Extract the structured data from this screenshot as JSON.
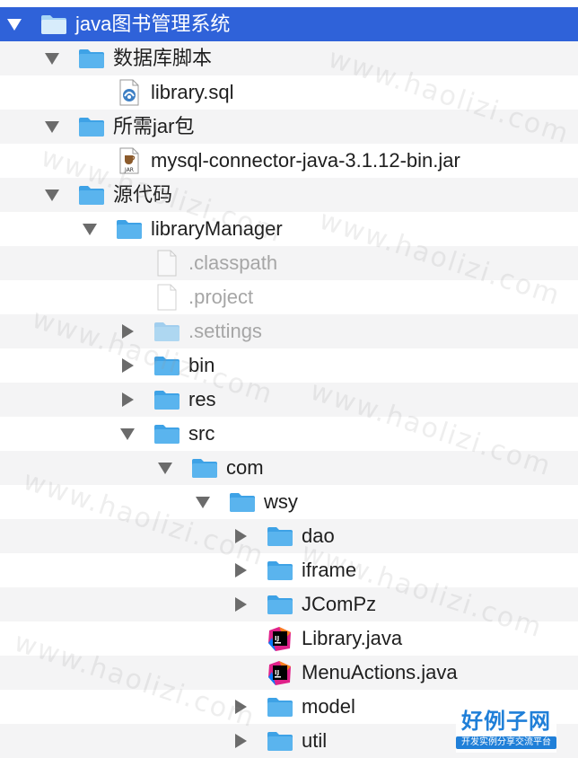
{
  "tree": {
    "root": {
      "label": "java图书管理系统"
    },
    "db_scripts": {
      "label": "数据库脚本"
    },
    "library_sql": {
      "label": "library.sql"
    },
    "jar_folder": {
      "label": "所需jar包"
    },
    "mysql_jar": {
      "label": "mysql-connector-java-3.1.12-bin.jar"
    },
    "jar_icon_text": "JAR",
    "source_code": {
      "label": "源代码"
    },
    "library_manager": {
      "label": "libraryManager"
    },
    "classpath": {
      "label": ".classpath"
    },
    "project": {
      "label": ".project"
    },
    "settings": {
      "label": ".settings"
    },
    "bin": {
      "label": "bin"
    },
    "res": {
      "label": "res"
    },
    "src": {
      "label": "src"
    },
    "com": {
      "label": "com"
    },
    "wsy": {
      "label": "wsy"
    },
    "dao": {
      "label": "dao"
    },
    "iframe": {
      "label": "iframe"
    },
    "jcompz": {
      "label": "JComPz"
    },
    "library_java": {
      "label": "Library.java"
    },
    "menuactions_java": {
      "label": "MenuActions.java"
    },
    "model": {
      "label": "model"
    },
    "util": {
      "label": "util"
    },
    "ij_icon_text": "IJ"
  },
  "watermark": {
    "text": "www.haolizi.com"
  },
  "brand": {
    "title": "好例子网",
    "subtitle": "开发实例分享交流平台"
  },
  "colors": {
    "selection": "#2f62d9",
    "folder": "#5ab4ee",
    "row_alt": "#f4f4f5",
    "brand": "#1f7fd8"
  }
}
